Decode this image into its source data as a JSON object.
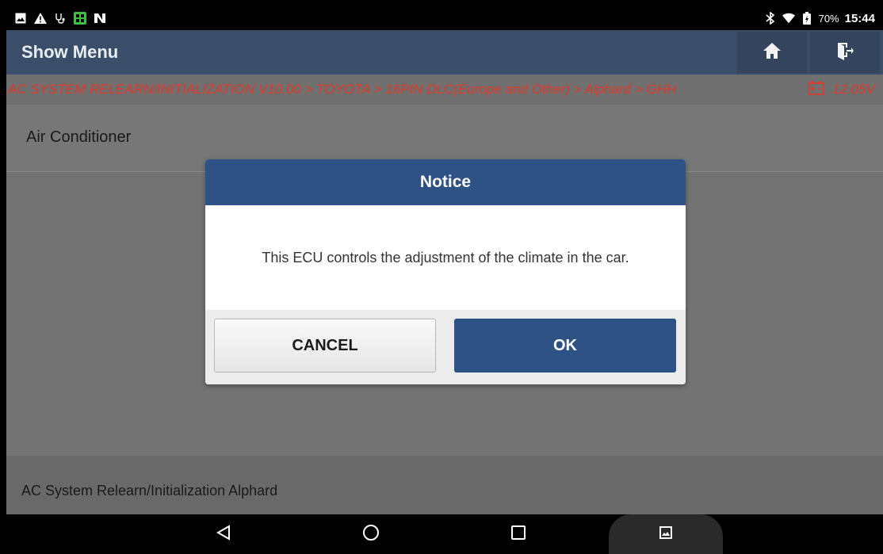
{
  "status_bar": {
    "left_icons": [
      "gallery-icon",
      "warning-icon",
      "stethoscope-icon",
      "app-icon",
      "n-icon"
    ],
    "right_icons": [
      "bluetooth-icon",
      "wifi-icon",
      "battery-icon"
    ],
    "battery": "70%",
    "time": "15:44"
  },
  "header": {
    "title": "Show Menu",
    "home_icon": "home-icon",
    "exit_icon": "exit-icon"
  },
  "breadcrumb": {
    "path": "AC SYSTEM RELEARN/INITIALIZATION V10.00 > TOYOTA > 16PIN DLC(Europe and Other) > Alphard > GHH",
    "voltage": "12.05V"
  },
  "section": {
    "label": "Air Conditioner"
  },
  "footer": {
    "text": "AC System Relearn/Initialization Alphard"
  },
  "dialog": {
    "title": "Notice",
    "message": "This ECU controls the adjustment of the climate in the car.",
    "cancel_label": "CANCEL",
    "ok_label": "OK"
  },
  "colors": {
    "header_bg": "#3a4d69",
    "dialog_accent": "#2e5286",
    "breadcrumb_text": "#e03a2a"
  }
}
